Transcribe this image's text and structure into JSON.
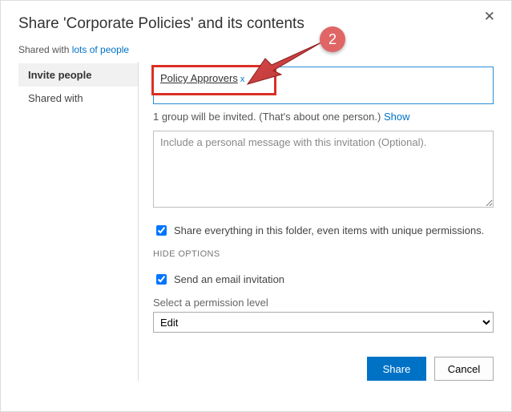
{
  "dialog": {
    "title": "Share 'Corporate Policies' and its contents",
    "shared_with_prefix": "Shared with ",
    "shared_with_link": "lots of people"
  },
  "tabs": {
    "invite": "Invite people",
    "shared": "Shared with"
  },
  "main": {
    "recipient": "Policy Approvers",
    "remove_x": "x",
    "invite_summary_pre": "1 group will be invited. (That's about one person.) ",
    "show_link": "Show",
    "message_placeholder": "Include a personal message with this invitation (Optional).",
    "share_everything": "Share everything in this folder, even items with unique permissions.",
    "hide_options": "HIDE OPTIONS",
    "send_email": "Send an email invitation",
    "perm_label": "Select a permission level",
    "perm_value": "Edit"
  },
  "buttons": {
    "share": "Share",
    "cancel": "Cancel"
  },
  "annotation": {
    "step": "2"
  }
}
